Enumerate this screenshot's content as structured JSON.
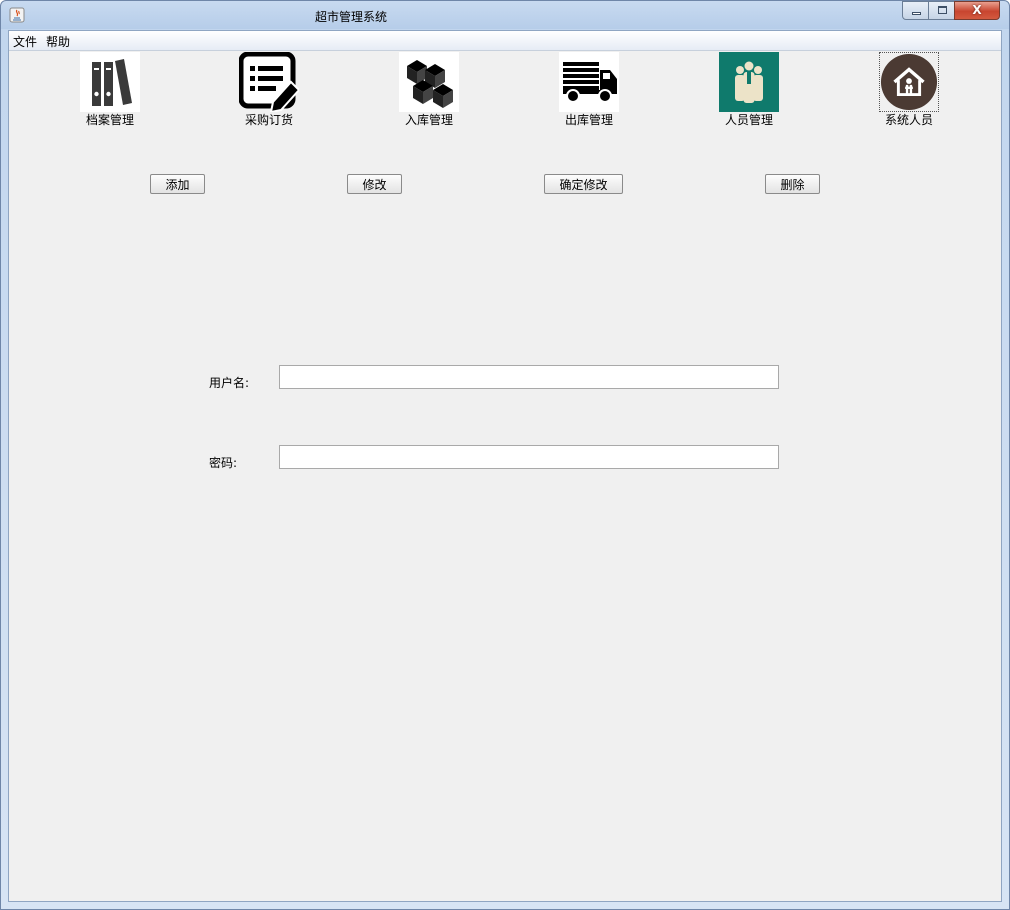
{
  "window": {
    "title": "超市管理系统"
  },
  "titlebar_controls": {
    "close_glyph": "X"
  },
  "menu": {
    "items": [
      "文件",
      "帮助"
    ]
  },
  "nav_icons": [
    {
      "label": "档案管理",
      "icon": "binders-icon"
    },
    {
      "label": "采购订货",
      "icon": "order-list-icon"
    },
    {
      "label": "入库管理",
      "icon": "boxes-icon"
    },
    {
      "label": "出库管理",
      "icon": "truck-icon"
    },
    {
      "label": "人员管理",
      "icon": "people-icon"
    },
    {
      "label": "系统人员",
      "icon": "home-user-icon"
    }
  ],
  "actions": {
    "add": "添加",
    "modify": "修改",
    "confirm_modify": "确定修改",
    "delete": "删除"
  },
  "form": {
    "username_label": "用户名:",
    "username_value": "",
    "password_label": "密码:",
    "password_value": ""
  },
  "colors": {
    "people_icon_bg": "#0f7a6c",
    "home_icon_bg": "#4b3a33"
  }
}
